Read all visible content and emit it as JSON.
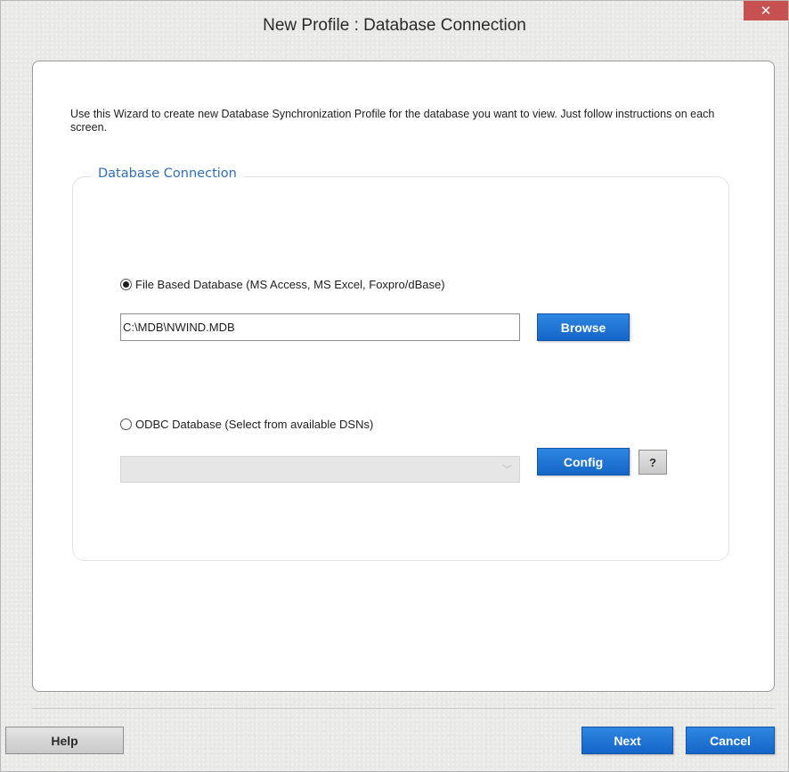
{
  "window": {
    "title": "New Profile : Database Connection",
    "close_glyph": "✕"
  },
  "intro": {
    "text": "Use this Wizard to create new Database Synchronization Profile for the database you want to view. Just follow instructions on each screen."
  },
  "group": {
    "legend": "Database Connection"
  },
  "file_option": {
    "label": "File Based Database (MS Access, MS Excel, Foxpro/dBase)",
    "selected": true,
    "path_value": "C:\\MDB\\NWIND.MDB",
    "browse_label": "Browse"
  },
  "odbc_option": {
    "label": "ODBC Database (Select from available DSNs)",
    "selected": false,
    "dsn_value": "",
    "config_label": "Config",
    "help_label": "?"
  },
  "footer": {
    "help_label": "Help",
    "next_label": "Next",
    "cancel_label": "Cancel"
  },
  "colors": {
    "accent": "#1a73d6",
    "legend_text": "#2f6fb8",
    "close_button": "#c75050"
  },
  "icons": {
    "close": "close-icon",
    "dropdown": "chevron-down-icon"
  }
}
